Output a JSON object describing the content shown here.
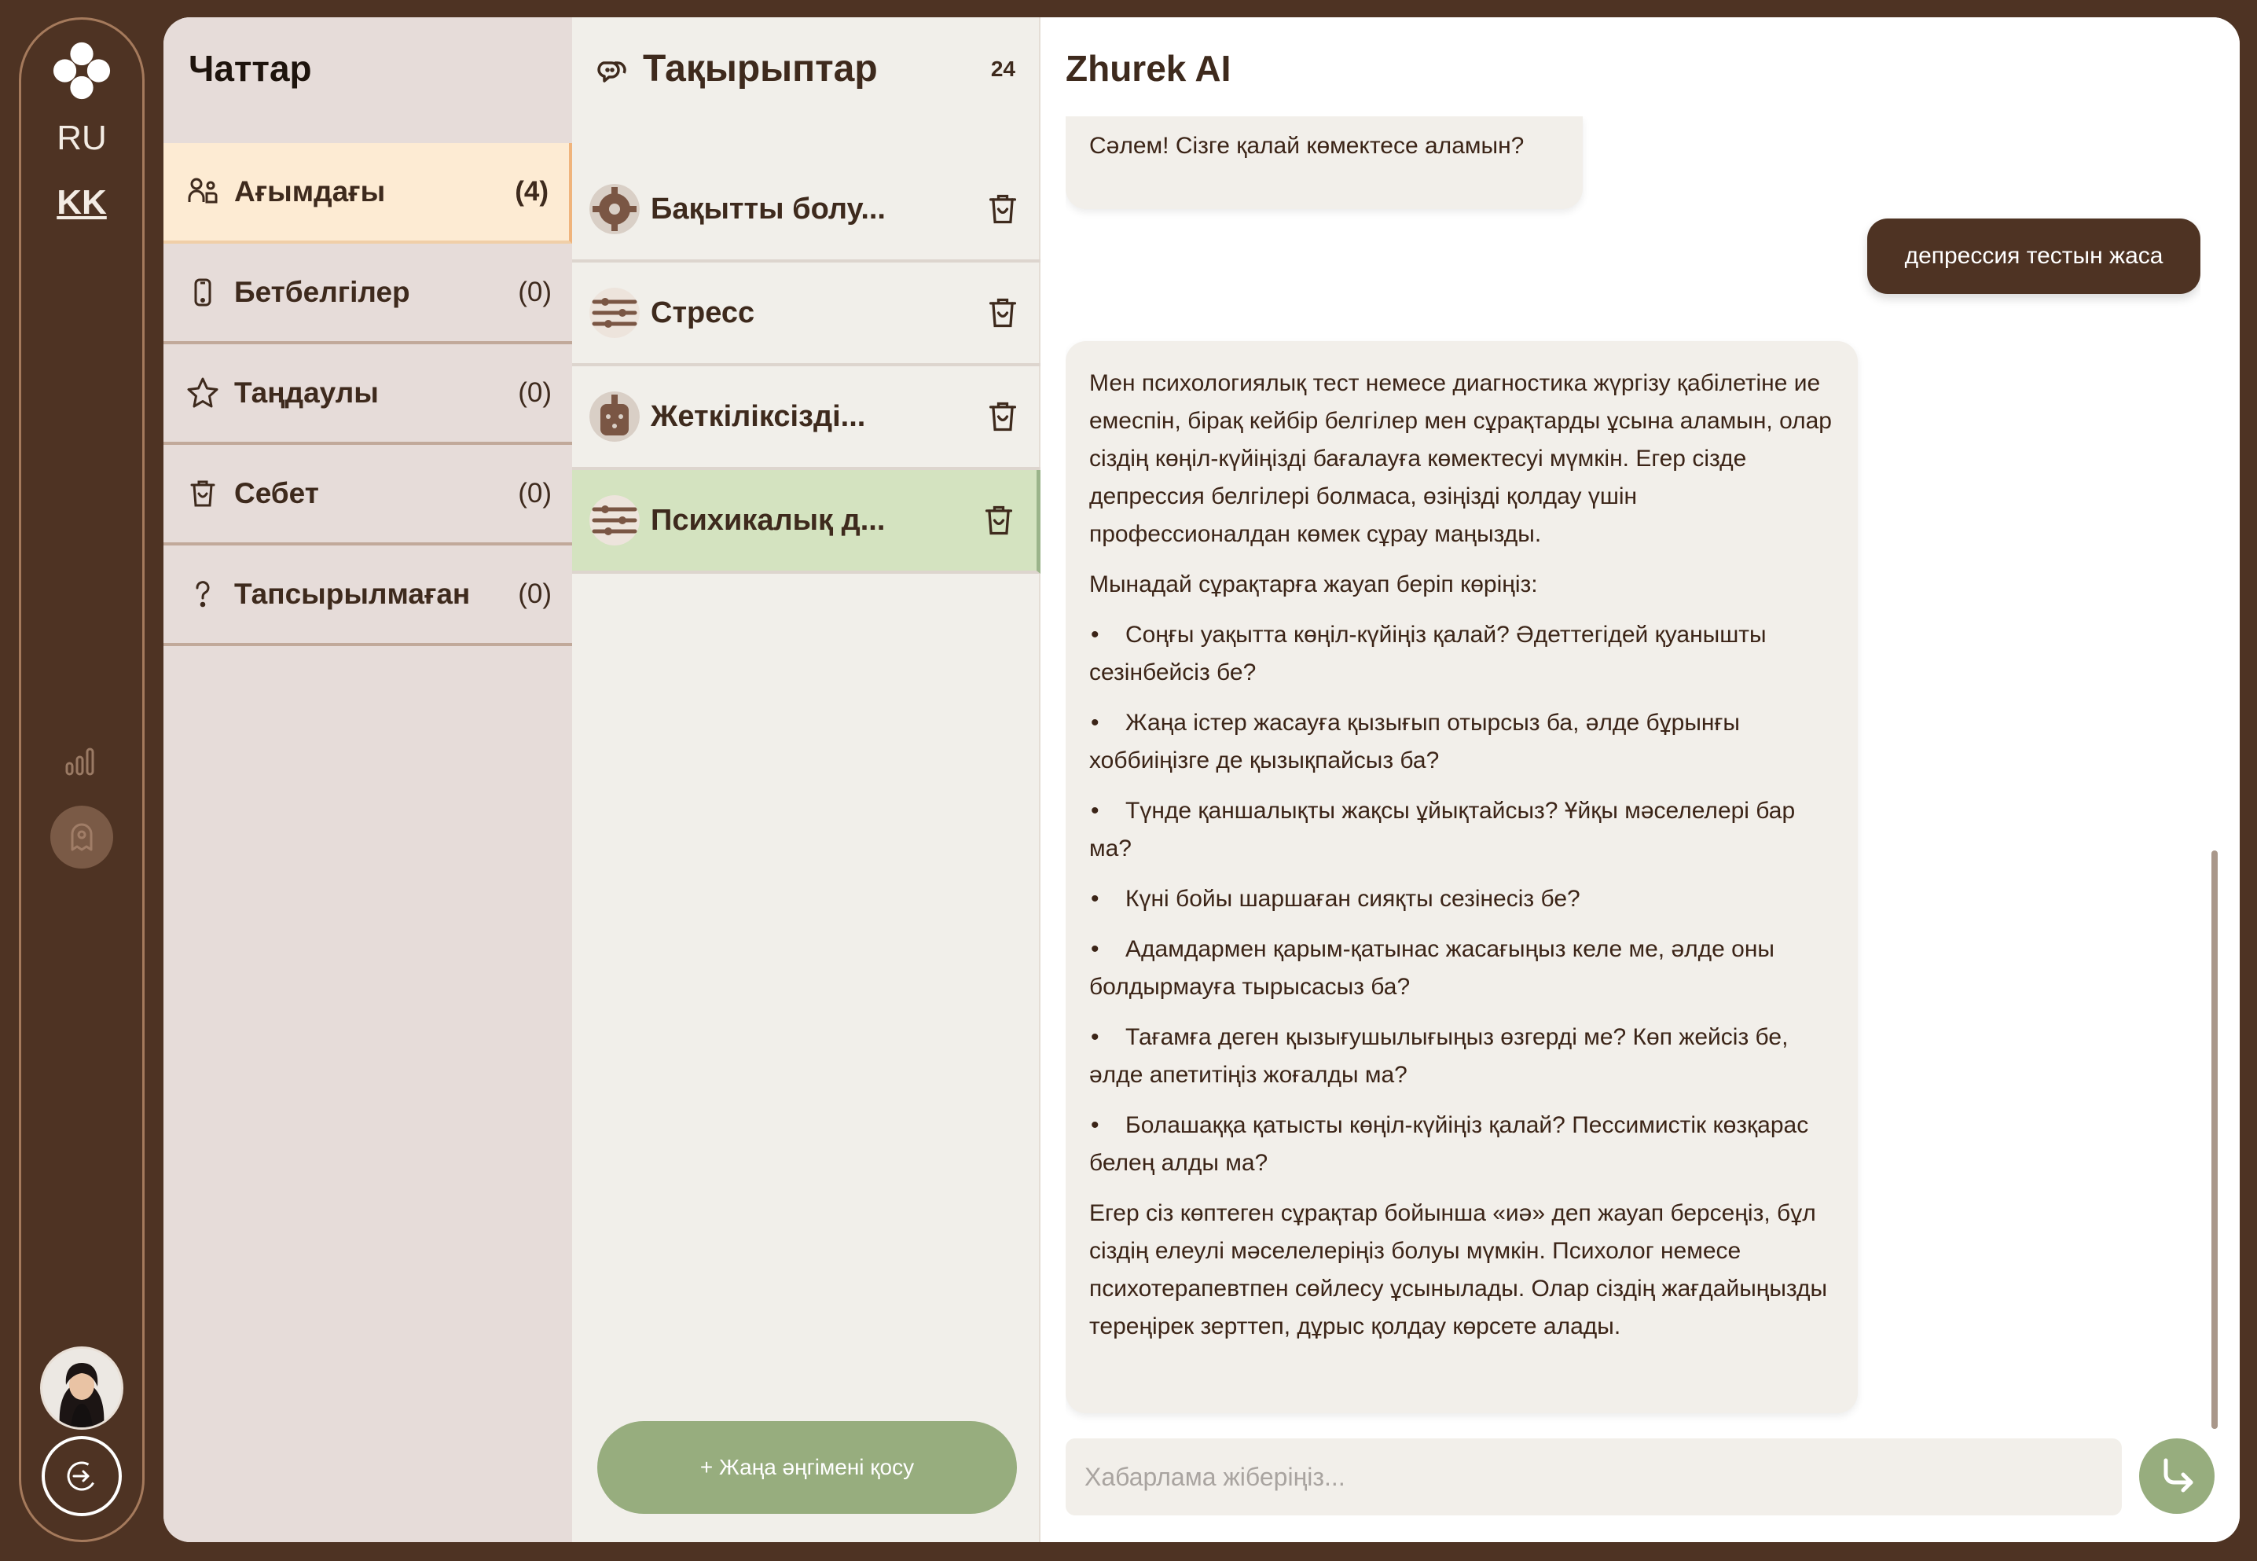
{
  "rail": {
    "languages": [
      "RU",
      "KK"
    ],
    "active_language": "KK"
  },
  "chats": {
    "title": "Чаттар",
    "categories": [
      {
        "icon": "users-icon",
        "label": "Ағымдағы",
        "count": "(4)"
      },
      {
        "icon": "phone-icon",
        "label": "Бетбелгілер",
        "count": "(0)"
      },
      {
        "icon": "star-icon",
        "label": "Таңдаулы",
        "count": "(0)"
      },
      {
        "icon": "trash-icon",
        "label": "Себет",
        "count": "(0)"
      },
      {
        "icon": "question-icon",
        "label": "Тапсырылмаған",
        "count": "(0)"
      }
    ]
  },
  "topics": {
    "title": "Тақырыптар",
    "count": "24",
    "items": [
      {
        "name": "Бақытты болу...",
        "icon": "gear-icon"
      },
      {
        "name": "Стресс",
        "icon": "sliders-icon"
      },
      {
        "name": "Жеткіліксізді...",
        "icon": "bag-icon"
      },
      {
        "name": "Психикалық д...",
        "icon": "sliders-icon"
      }
    ],
    "new_chat_label": "+ Жаңа әңгімені қосу"
  },
  "chat": {
    "title": "Zhurek AI",
    "greeting": "Сәлем! Сізге қалай көмектесе аламын?",
    "user_message": "депрессия тестын жаса",
    "reply": {
      "intro": "Мен психологиялық тест немесе диагностика жүргізу қабілетіне ие емеспін, бірақ кейбір белгілер мен сұрақтарды ұсына аламын, олар сіздің көңіл-күйіңізді бағалауға көмектесуі мүмкін. Егер сізде депрессия белгілері болмаса, өзіңізді қолдау үшін профессионалдан көмек сұрау маңызды.",
      "lead": "Мынадай сұрақтарға жауап беріп көріңіз:",
      "questions": [
        "Соңғы уақытта көңіл-күйіңіз қалай? Әдеттегідей қуанышты сезінбейсіз бе?",
        "Жаңа істер жасауға қызығып отырсыз ба, әлде бұрынғы хоббиіңізге де қызықпайсыз ба?",
        "Түнде қаншалықты жақсы ұйықтайсыз? Ұйқы мәселелері бар ма?",
        "Күні бойы шаршаған сияқты сезінесіз бе?",
        "Адамдармен қарым-қатынас жасағыңыз келе ме, әлде оны болдырмауға тырысасыз ба?",
        "Тағамға деген қызығушылығыңыз өзгерді ме? Көп жейсіз бе, әлде апетитіңіз жоғалды ма?",
        "Болашаққа қатысты көңіл-күйіңіз қалай? Пессимистік көзқарас белең алды ма?"
      ],
      "outro": "Егер сіз көптеген сұрақтар бойынша «иә» деп жауап берсеңіз, бұл сіздің елеулі мәселелеріңіз болуы мүмкін. Психолог немесе психотерапевтпен сөйлесу ұсынылады. Олар сіздің жағдайыңызды тереңірек зерттеп, дұрыс қолдау көрсете алады."
    },
    "input_placeholder": "Хабарлама жіберіңіз..."
  },
  "colors": {
    "frame": "#4e3323",
    "active_category": "#fdebd3",
    "active_topic": "#d4e3c0",
    "accent_green": "#97ad7e"
  }
}
